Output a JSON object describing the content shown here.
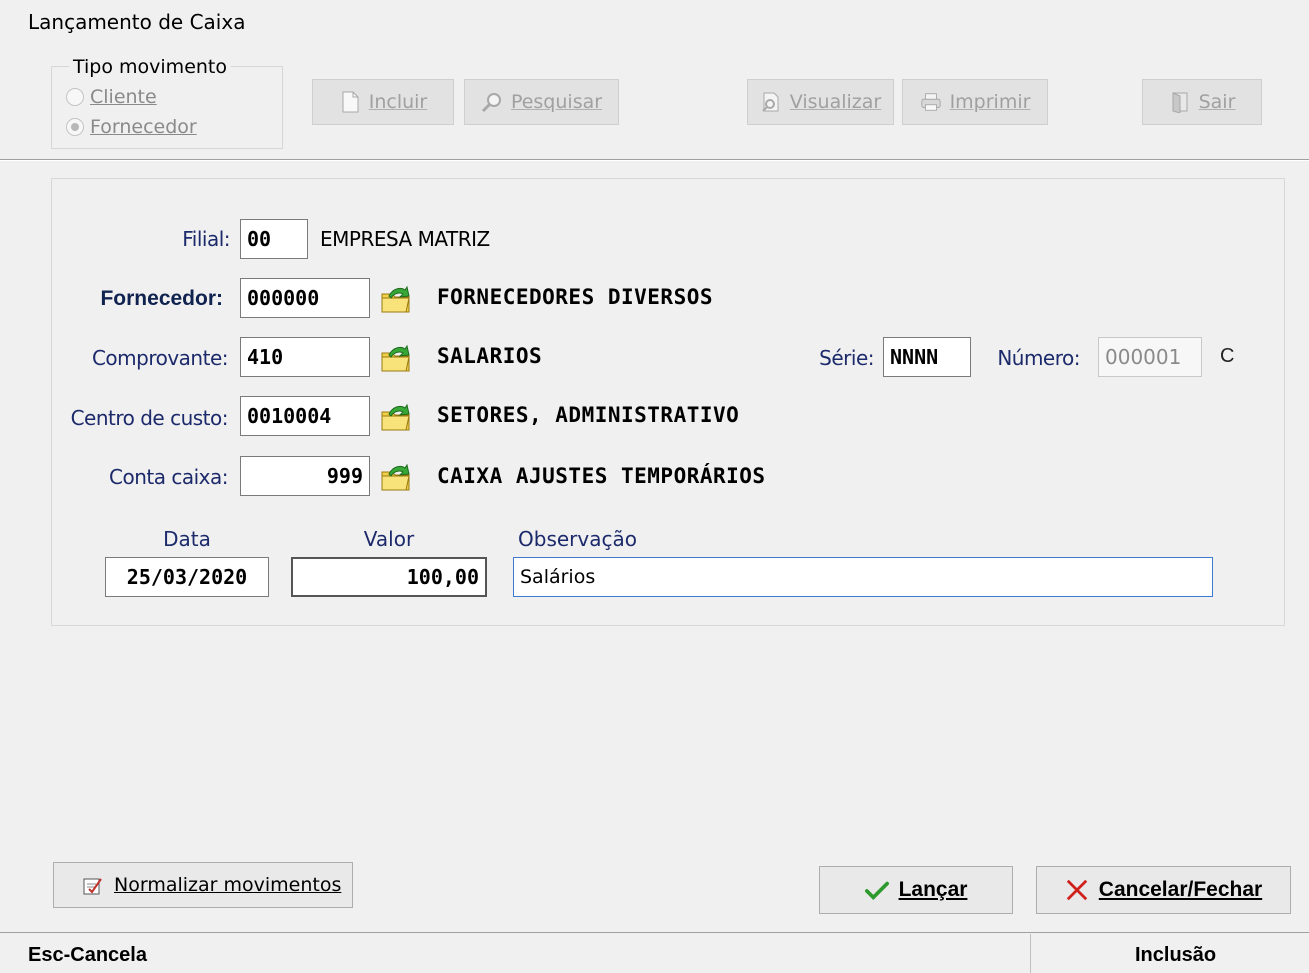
{
  "window": {
    "title": "Lançamento de Caixa"
  },
  "tipo_movimento": {
    "label": "Tipo movimento",
    "options": [
      {
        "label": "Cliente",
        "selected": false
      },
      {
        "label": "Fornecedor",
        "selected": true
      }
    ]
  },
  "toolbar": {
    "incluir": "Incluir",
    "pesquisar": "Pesquisar",
    "visualizar": "Visualizar",
    "imprimir": "Imprimir",
    "sair": "Sair"
  },
  "form": {
    "filial": {
      "label": "Filial:",
      "value": "00",
      "desc": "EMPRESA MATRIZ"
    },
    "fornecedor": {
      "label": "Fornecedor:",
      "value": "000000",
      "desc": "FORNECEDORES DIVERSOS"
    },
    "comprovante": {
      "label": "Comprovante:",
      "value": "410",
      "desc": "SALARIOS"
    },
    "serie": {
      "label": "Série:",
      "value": "NNNN"
    },
    "numero": {
      "label": "Número:",
      "value": "000001",
      "suffix": "C"
    },
    "centro_custo": {
      "label": "Centro de custo:",
      "value": "0010004",
      "desc": "SETORES, ADMINISTRATIVO"
    },
    "conta_caixa": {
      "label": "Conta caixa:",
      "value": "999",
      "desc": "CAIXA AJUSTES TEMPORÁRIOS"
    },
    "data": {
      "label": "Data",
      "value": "25/03/2020"
    },
    "valor": {
      "label": "Valor",
      "value": "100,00"
    },
    "observacao": {
      "label": "Observação",
      "value": "Salários"
    }
  },
  "actions": {
    "normalizar": "Normalizar movimentos",
    "lancar": "Lançar",
    "cancelar": "Cancelar/Fechar"
  },
  "status": {
    "left": "Esc-Cancela",
    "right": "Inclusão"
  },
  "colors": {
    "label_blue": "#1c2a6b",
    "accent_green": "#2e9a2e",
    "cancel_red": "#d0201c"
  }
}
